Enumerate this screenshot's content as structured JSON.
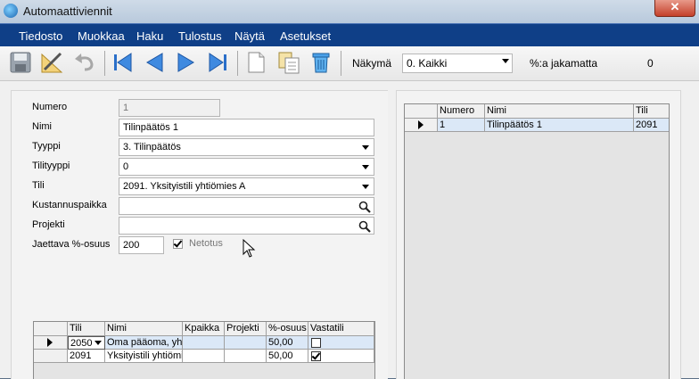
{
  "window": {
    "title": "Automaattiviennit",
    "close_label": "✕"
  },
  "menu": [
    "Tiedosto",
    "Muokkaa",
    "Haku",
    "Tulostus",
    "Näytä",
    "Asetukset"
  ],
  "toolbar": {
    "view_label": "Näkymä",
    "view_value": "0. Kaikki",
    "unallocated_label": "%:a jakamatta",
    "unallocated_value": "0"
  },
  "form": {
    "numero": {
      "label": "Numero",
      "value": "1"
    },
    "nimi": {
      "label": "Nimi",
      "value": "Tilinpäätös 1"
    },
    "tyyppi": {
      "label": "Tyyppi",
      "value": "3. Tilinpäätös"
    },
    "tilityyppi": {
      "label": "Tilityyppi",
      "value": "0"
    },
    "tili": {
      "label": "Tili",
      "value": "2091. Yksityistili yhtiömies A"
    },
    "kustannuspaikka": {
      "label": "Kustannuspaikka",
      "value": ""
    },
    "projekti": {
      "label": "Projekti",
      "value": ""
    },
    "jaettava": {
      "label": "Jaettava %-osuus",
      "value": "200"
    },
    "netotus": {
      "label": "Netotus",
      "checked": true
    }
  },
  "detail_grid": {
    "columns": [
      "Tili",
      "Nimi",
      "Kpaikka",
      "Projekti",
      "%-osuus",
      "Vastatili"
    ],
    "rows": [
      {
        "tili": "2050",
        "nimi": "Oma pääoma, yht",
        "kpaikka": "",
        "projekti": "",
        "osuus": "50,00",
        "vastatili": false
      },
      {
        "tili": "2091",
        "nimi": "Yksityistili yhtiömi",
        "kpaikka": "",
        "projekti": "",
        "osuus": "50,00",
        "vastatili": true
      }
    ]
  },
  "list_grid": {
    "columns": [
      "Numero",
      "Nimi",
      "Tili"
    ],
    "rows": [
      {
        "numero": "1",
        "nimi": "Tilinpäätös 1",
        "tili": "2091"
      }
    ]
  }
}
